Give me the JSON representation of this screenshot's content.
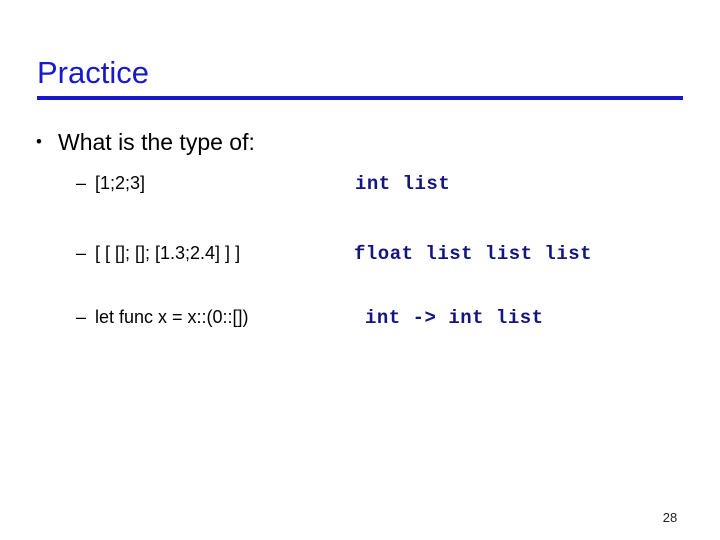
{
  "slide": {
    "title": "Practice",
    "accent_color": "#1818cc",
    "answer_color": "#151580",
    "body_color": "#000000",
    "background_color": "#ffffff",
    "page_number": "28",
    "bullet": {
      "marker": "•",
      "text": "What is the type of:"
    },
    "items": [
      {
        "marker": "–",
        "expression": "[1;2;3]",
        "answer": "int list"
      },
      {
        "marker": "–",
        "expression": "[ [ []; []; [1.3;2.4] ] ]",
        "answer": "float list list list"
      },
      {
        "marker": "–",
        "expression": "let func x = x::(0::[])",
        "answer": "int -> int list"
      }
    ]
  }
}
